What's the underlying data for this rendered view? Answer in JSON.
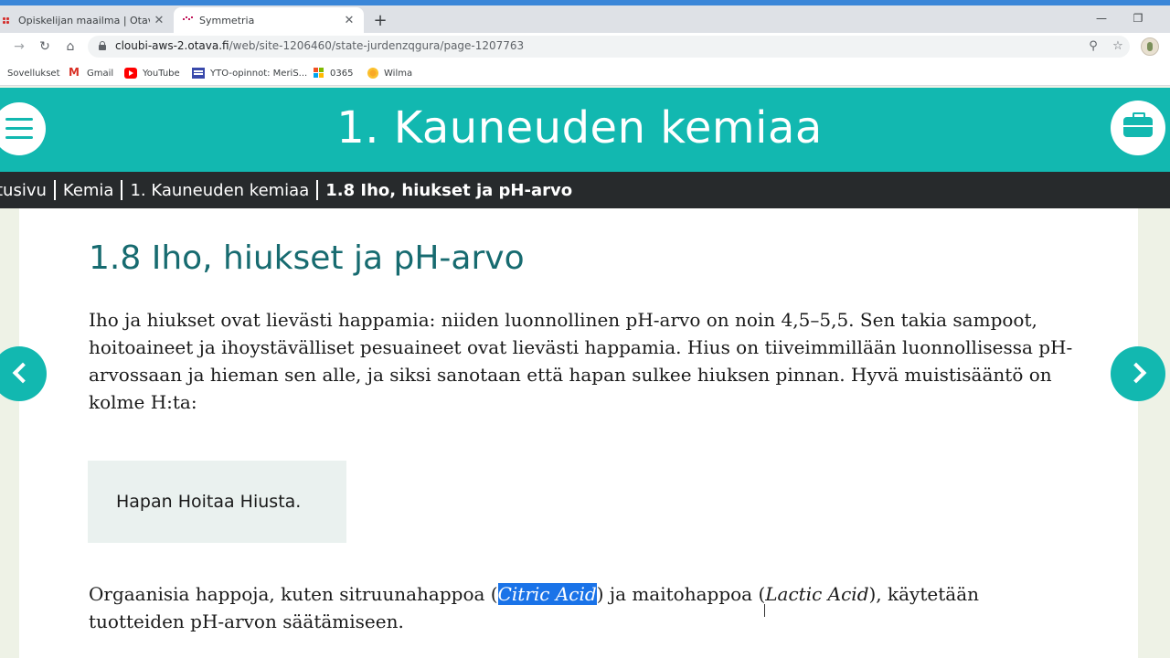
{
  "browser": {
    "tabs": [
      {
        "title": "Opiskelijan maailma | Otava",
        "active": false,
        "close": "✕"
      },
      {
        "title": "Symmetria",
        "active": true,
        "close": "✕"
      }
    ],
    "new_tab": "+",
    "window_controls": {
      "minimize": "—",
      "restore": "❐"
    },
    "nav": {
      "back": "→",
      "reload": "↻",
      "home": "⌂"
    },
    "url_host": "cloubi-aws-2.otava.fi",
    "url_path": "/web/site-1206460/state-jurdenzqgura/page-1207763",
    "omnibox_icons": {
      "zoom": "⚲",
      "star": "☆"
    },
    "bookmarks": [
      {
        "label": "Sovellukset",
        "icon": "apps-icon"
      },
      {
        "label": "Gmail",
        "icon": "gmail-icon"
      },
      {
        "label": "YouTube",
        "icon": "youtube-icon"
      },
      {
        "label": "YTO-opinnot: MeriS...",
        "icon": "yto-icon"
      },
      {
        "label": "0365",
        "icon": "office-icon"
      },
      {
        "label": "Wilma",
        "icon": "wilma-icon"
      }
    ]
  },
  "page": {
    "title": "1. Kauneuden kemiaa",
    "breadcrumb": [
      "tusivu",
      "Kemia",
      "1. Kauneuden kemiaa",
      "1.8 Iho, hiukset ja pH-arvo"
    ],
    "section_title": "1.8 Iho, hiukset ja pH-arvo",
    "paragraph1": "Iho ja hiukset ovat lievästi happamia: niiden luonnollinen pH-arvo on noin 4,5–5,5. Sen takia sampoot, hoitoaineet ja ihoystävälliset pesuaineet ovat lievästi happamia. Hius on tiiveimmillään luonnollisessa pH-arvossaan ja hieman sen alle, ja siksi sanotaan että hapan sulkee hiuksen pinnan. Hyvä muistisääntö on kolme H:ta:",
    "callout": "Hapan Hoitaa Hiusta.",
    "paragraph2": {
      "part1": "Orgaanisia happoja, kuten sitruunahappoa (",
      "highlight": "Citric Acid",
      "part2": ") ja maitohappoa (",
      "italic": "Lactic Acid",
      "part3": "), käytetään tuotteiden pH-arvon säätämiseen."
    }
  },
  "colors": {
    "accent": "#12b8b0",
    "heading": "#176b70",
    "breadcrumb_bg": "#272a2c",
    "selection": "#1a73e8"
  }
}
